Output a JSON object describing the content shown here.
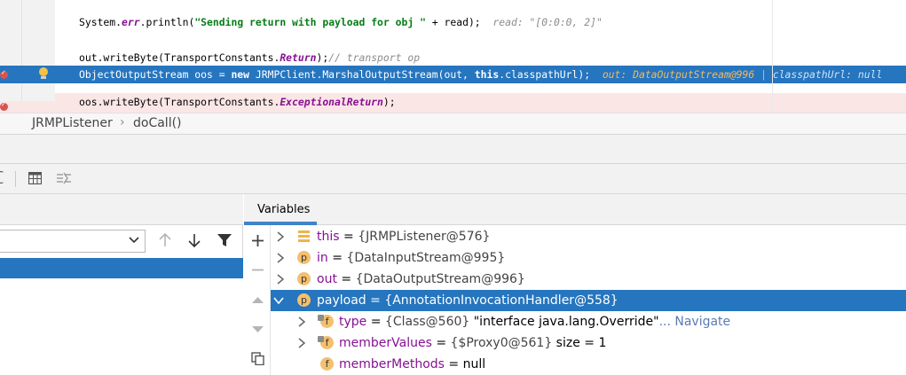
{
  "editor": {
    "line1": {
      "code_prefix": "System.",
      "code_err": "err",
      "code_mid": ".println(",
      "code_str": "\"Sending return with payload for obj \"",
      "code_suffix": " + read);",
      "hint": "read: \"[0:0:0, 2]\""
    },
    "line2": {
      "code_prefix": "out.writeByte(TransportConstants.",
      "code_field": "Return",
      "code_suffix": ");",
      "comment": "// transport op"
    },
    "line3": {
      "code_a": "ObjectOutputStream oos = ",
      "code_new": "new",
      "code_b": " JRMPClient.MarshalOutputStream(out, ",
      "code_this": "this",
      "code_c": ".classpathUrl);",
      "hint_out": "out: DataOutputStream@996",
      "hint_cp": "classpathUrl: null"
    },
    "line4": {
      "code_prefix": "oos.writeByte(TransportConstants.",
      "code_field": "ExceptionalReturn",
      "code_suffix": ");"
    }
  },
  "breadcrumb": {
    "class_name": "JRMPListener",
    "separator": "›",
    "method_name": "doCall()"
  },
  "toolbar": {
    "cut_glyph": "ʗ"
  },
  "frames": {
    "combo_arrow_icon": "chevron-down-icon"
  },
  "variables": {
    "tab_label": "Variables",
    "rows": [
      {
        "name": "this",
        "eq": " = ",
        "value": "{JRMPListener@576}"
      },
      {
        "icon": "p",
        "name": "in",
        "eq": " = ",
        "value": "{DataInputStream@995}"
      },
      {
        "icon": "p",
        "name": "out",
        "eq": " = ",
        "value": "{DataOutputStream@996}"
      },
      {
        "icon": "p",
        "name": "payload",
        "eq": " = ",
        "value": "{AnnotationInvocationHandler@558}"
      },
      {
        "icon": "f",
        "name": "type",
        "eq": " = ",
        "value": "{Class@560}",
        "extra": " \"interface java.lang.Override\"",
        "nav": "... Navigate"
      },
      {
        "icon": "f",
        "name": "memberValues",
        "eq": " = ",
        "value": "{$Proxy0@561}",
        "extra": "  size = 1"
      },
      {
        "icon": "f",
        "name": "memberMethods",
        "eq": " = ",
        "value": "null"
      }
    ]
  },
  "colors": {
    "selection": "#2675bf",
    "tab_underline": "#4083c9",
    "breakpoint": "#d9534f"
  }
}
